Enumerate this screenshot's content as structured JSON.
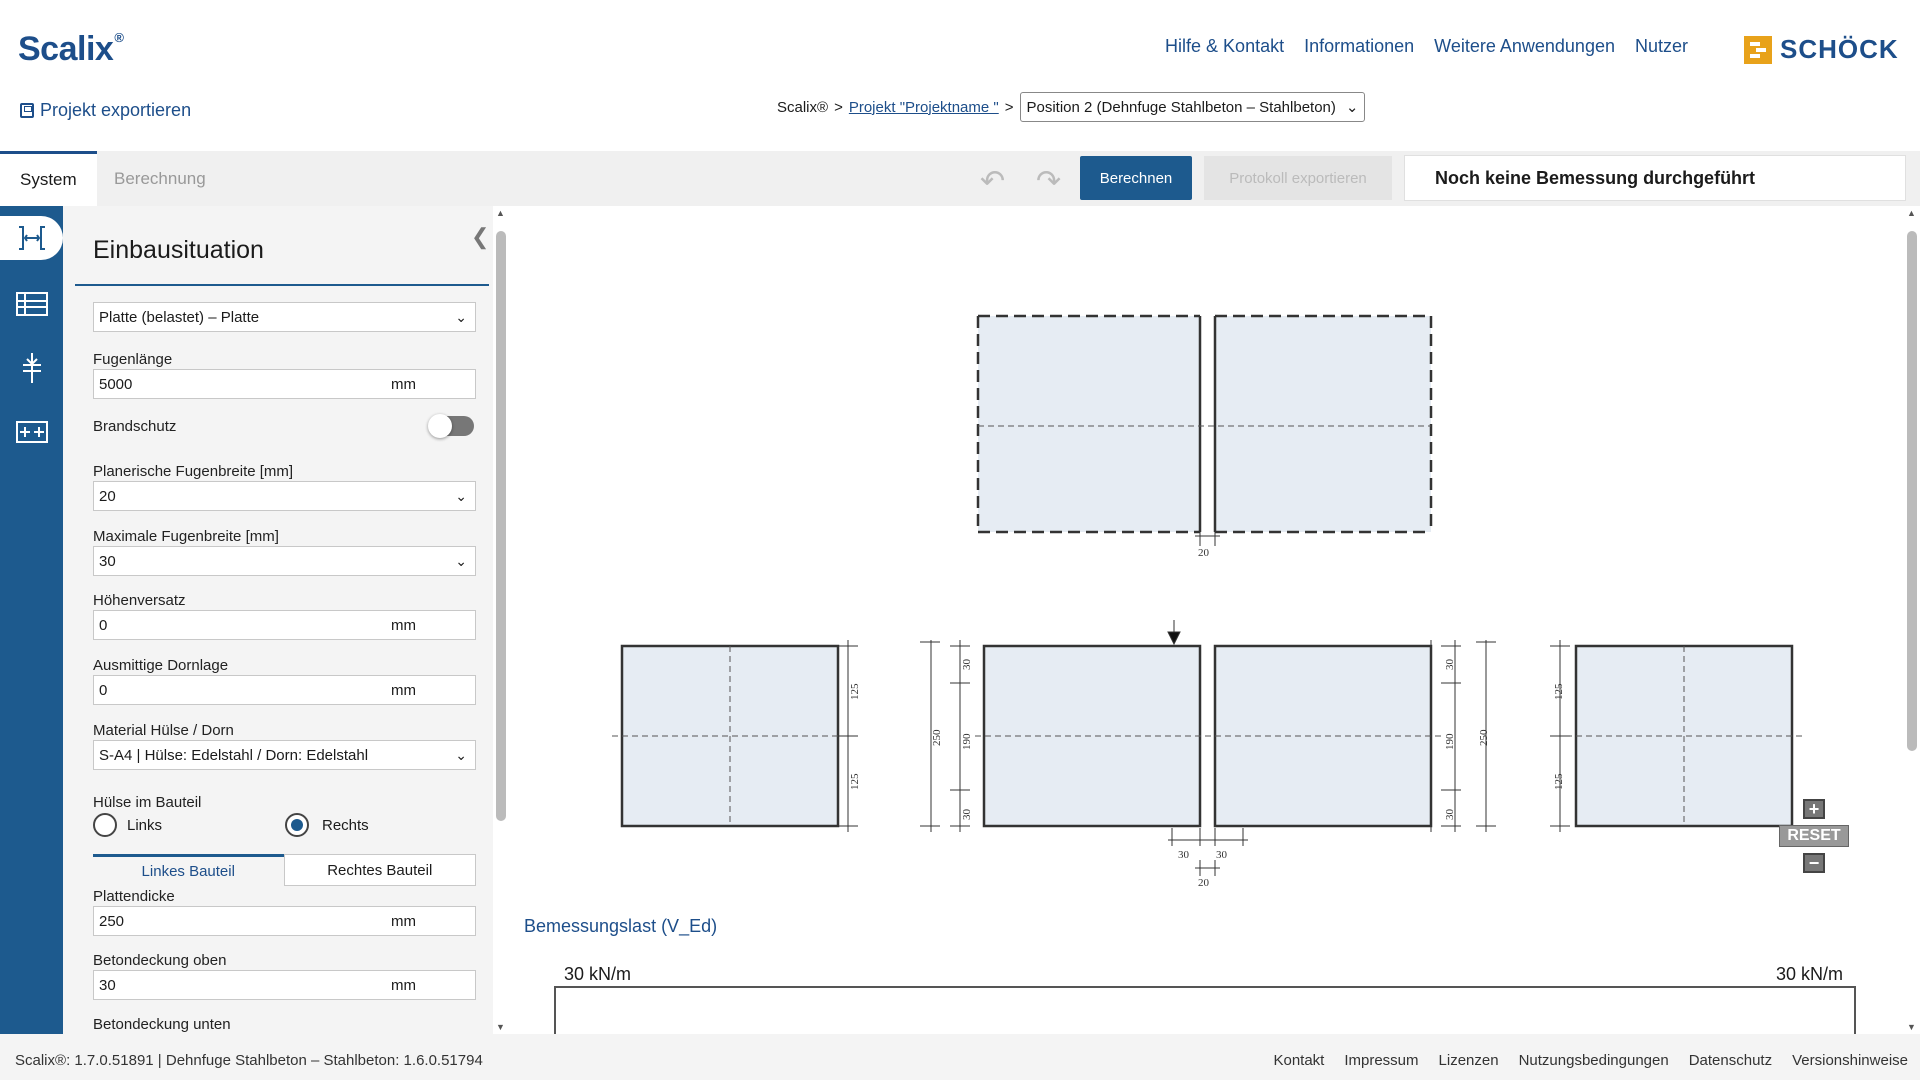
{
  "header": {
    "logo": "Scalix",
    "logo_reg": "®",
    "nav": [
      "Hilfe & Kontakt",
      "Informationen",
      "Weitere Anwendungen",
      "Nutzer"
    ],
    "brand": "SCHÖCK",
    "brand_color": "#e8a21a",
    "export_label": "Projekt exportieren"
  },
  "breadcrumb": {
    "root": "Scalix®",
    "sep": ">",
    "project": "Projekt \"Projektname \"",
    "position": "Position 2 (Dehnfuge Stahlbeton – Stahlbeton)"
  },
  "toolbar": {
    "tab_system": "System",
    "tab_calc": "Berechnung",
    "calc_button": "Berechnen",
    "export_protocol": "Protokoll exportieren",
    "status": "Noch keine Bemessung durchgeführt"
  },
  "panel": {
    "title": "Einbausituation",
    "situation": "Platte (belastet) – Platte",
    "joint_length": {
      "label": "Fugenlänge",
      "value": "5000",
      "unit": "mm"
    },
    "fire": {
      "label": "Brandschutz",
      "on": false
    },
    "planned_width": {
      "label": "Planerische Fugenbreite [mm]",
      "value": "20"
    },
    "max_width": {
      "label": "Maximale Fugenbreite [mm]",
      "value": "30"
    },
    "offset": {
      "label": "Höhenversatz",
      "value": "0",
      "unit": "mm"
    },
    "eccentric": {
      "label": "Ausmittige Dornlage",
      "value": "0",
      "unit": "mm"
    },
    "material": {
      "label": "Material Hülse / Dorn",
      "value": "S-A4 | Hülse: Edelstahl / Dorn: Edelstahl"
    },
    "sleeve": {
      "label": "Hülse im Bauteil",
      "left": "Links",
      "right": "Rechts",
      "selected": "Rechts"
    },
    "subtabs": [
      "Linkes Bauteil",
      "Rechtes Bauteil"
    ],
    "thickness": {
      "label": "Plattendicke",
      "value": "250",
      "unit": "mm"
    },
    "cover_top": {
      "label": "Betondeckung oben",
      "value": "30",
      "unit": "mm"
    },
    "cover_bottom": {
      "label": "Betondeckung unten"
    }
  },
  "drawing": {
    "joint_width": "20",
    "dims_h": [
      "125",
      "125"
    ],
    "dims_mid": [
      "30",
      "190",
      "30",
      "250"
    ],
    "gap_dims": [
      "30",
      "30",
      "20"
    ],
    "reset": "RESET",
    "slab_fill": "#e6ecf3"
  },
  "load": {
    "title": "Bemessungslast (V_Ed)",
    "left": "30 kN/m",
    "right": "30 kN/m"
  },
  "footer": {
    "version": "Scalix®: 1.7.0.51891 | Dehnfuge Stahlbeton – Stahlbeton: 1.6.0.51794",
    "links": [
      "Kontakt",
      "Impressum",
      "Lizenzen",
      "Nutzungsbedingungen",
      "Datenschutz",
      "Versionshinweise"
    ]
  }
}
